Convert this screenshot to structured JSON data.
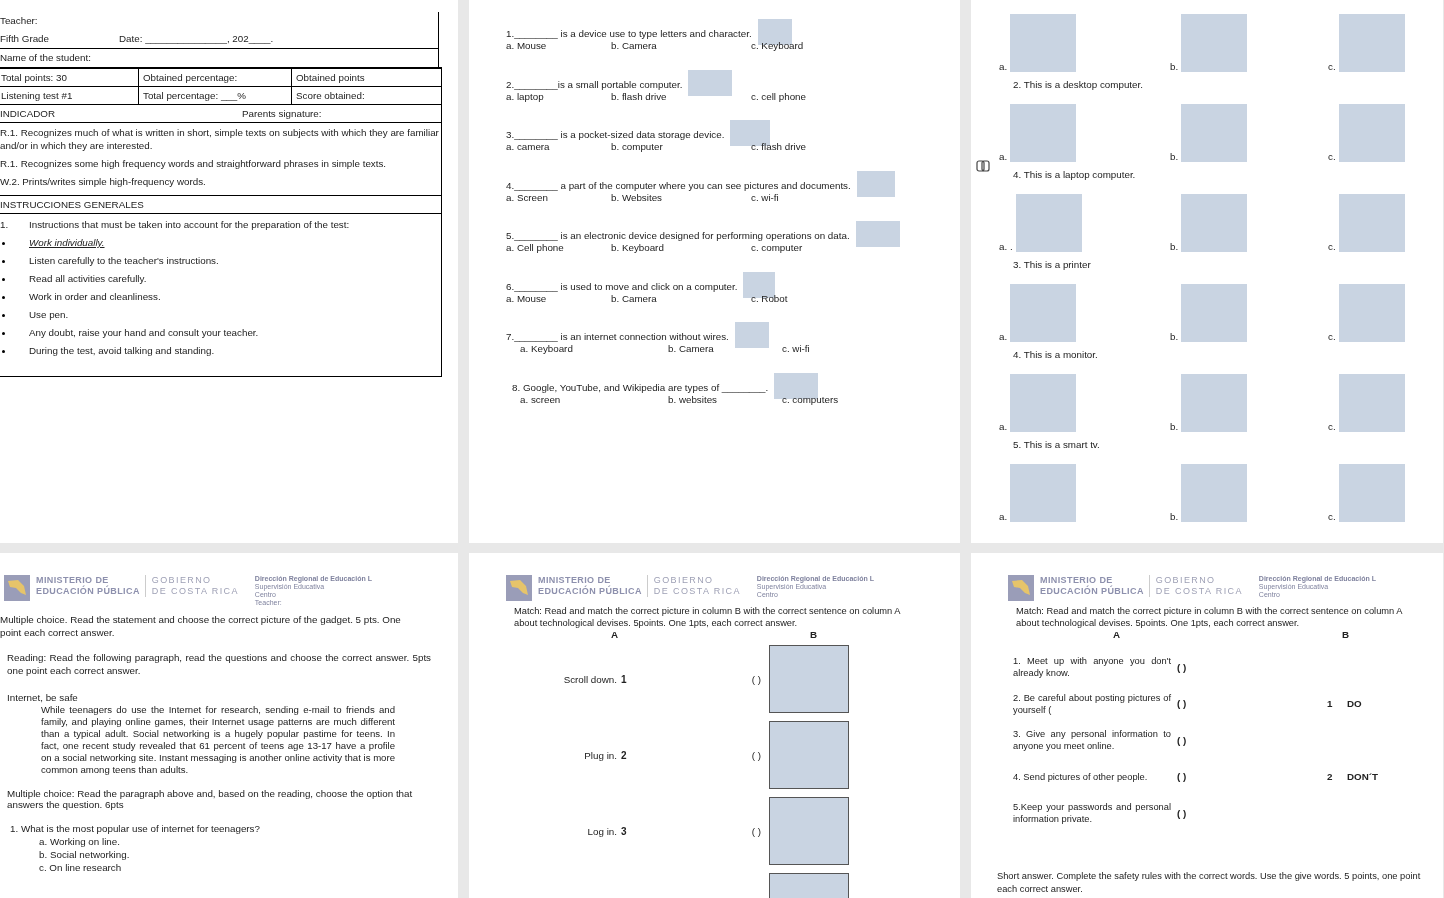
{
  "page_1": {
    "teacher": "Teacher:",
    "grade": "Fifth Grade",
    "date": "Date: _______________, 202____.",
    "student": "Name of the student:",
    "score_rows": [
      [
        "Total points: 30",
        "Obtained percentage:",
        "Obtained points"
      ],
      [
        "Listening test #1",
        "Total percentage: ___%",
        "Score obtained:"
      ]
    ],
    "indicator": "INDICADOR",
    "signature": "Parents signature:",
    "indicators": [
      "R.1. Recognizes much of what is written in short, simple texts on subjects with which they are familiar and/or in which they are interested.",
      "R.1. Recognizes some high frequency words and straightforward phrases in simple texts.",
      "W.2. Prints/writes simple high-frequency words."
    ],
    "instructions_title": "INSTRUCCIONES GENERALES",
    "instruction_number": "1.",
    "instruction_lead": "Instructions that must be taken into account for the preparation of the test:",
    "rules": [
      {
        "text": "Work individually.",
        "emphasized": true
      },
      {
        "text": "Listen carefully to the teacher's instructions.",
        "emphasized": false
      },
      {
        "text": "Read all activities carefully.",
        "emphasized": false
      },
      {
        "text": "Work in order and cleanliness.",
        "emphasized": false
      },
      {
        "text": "Use pen.",
        "emphasized": false
      },
      {
        "text": "Any doubt, raise your hand and consult your teacher.",
        "emphasized": false
      },
      {
        "text": "During the test, avoid talking and standing.",
        "emphasized": false
      }
    ]
  },
  "page_2": {
    "questions": [
      {
        "text": "1.________ is a device use to type letters and character.",
        "options": [
          "a.  Mouse",
          "b. Camera",
          "c. Keyboard"
        ]
      },
      {
        "text": "2.________is a small portable computer.",
        "options": [
          "a.  laptop",
          "b. flash drive",
          "c. cell phone"
        ]
      },
      {
        "text": "3.________ is a pocket-sized data storage device.",
        "options": [
          "a.  camera",
          "b. computer",
          "c. flash drive"
        ]
      },
      {
        "text": "4.________ a part of the computer where you can see pictures and documents.",
        "options": [
          "a.  Screen",
          "b. Websites",
          "c. wi-fi"
        ]
      },
      {
        "text": "5.________ is an electronic device designed for performing operations on data.",
        "options": [
          "a.  Cell phone",
          "b. Keyboard",
          "c. computer"
        ]
      },
      {
        "text": "6.________ is used to move and click on a computer.",
        "options": [
          "a.  Mouse",
          "b. Camera",
          "c. Robot"
        ]
      },
      {
        "text": "7.________ is an internet connection without wires.",
        "options": [
          "a.  Keyboard",
          "b. Camera",
          "c. wi-fi"
        ]
      },
      {
        "text": "8.  Google, YouTube, and Wikipedia are types of ________.",
        "options": [
          "a.  screen",
          "b. websites",
          "c. computers"
        ]
      }
    ]
  },
  "page_3": {
    "rows": [
      {
        "labels": [
          "a.",
          "b.",
          "c."
        ]
      },
      {
        "caption": "2.  This is a desktop computer.",
        "labels": [
          "a.",
          "b.",
          "c."
        ]
      },
      {
        "caption": "4. This is a laptop computer.",
        "labels": [
          "a. .",
          "b.",
          "c."
        ]
      },
      {
        "caption": "3.  This is a printer",
        "labels": [
          "a.",
          "b.",
          "c."
        ]
      },
      {
        "caption": "4.  This is a monitor.",
        "labels": [
          "a.",
          "b.",
          "c."
        ]
      },
      {
        "caption": "5.  This is a smart tv.",
        "labels": [
          "a.",
          "b.",
          "c."
        ]
      }
    ]
  },
  "page_4": {
    "header": {
      "ministry": [
        "MINISTERIO DE",
        "EDUCACIÓN PÚBLICA"
      ],
      "government": [
        "GOBIERNO",
        "DE COSTA RICA"
      ],
      "office": [
        "Dirección Regional de Educación L",
        "Supervisión Educativa",
        "Centro",
        "Teacher:"
      ]
    },
    "gadget_instruction": "Multiple choice. Read the statement and choose the correct picture of the gadget. 5 pts. One point each correct answer.",
    "reading_instruction": "Reading: Read the following paragraph, read the questions and choose the correct answer. 5pts one point each correct answer.",
    "reading_title": "Internet, be safe",
    "reading_text": "While teenagers do use the Internet for research, sending e-mail to friends and family, and playing online games, their Internet usage patterns are much different than a typical adult. Social networking is a hugely popular pastime for teens. In fact, one recent study revealed that 61 percent of teens age 13-17 have a profile on a social networking site. Instant messaging is another online activity that is more common among teens than adults.",
    "choice_instruction": "Multiple choice: Read the paragraph above and, based on the reading, choose the option that answers the question. 6pts",
    "question": "1.  What is the most popular use of internet for teenagers?",
    "options": [
      "a.  Working on line.",
      "b.  Social networking.",
      "c.  On line research"
    ]
  },
  "page_5": {
    "header": {
      "ministry": [
        "MINISTERIO DE",
        "EDUCACIÓN PÚBLICA"
      ],
      "government": [
        "GOBIERNO",
        "DE COSTA RICA"
      ],
      "office": [
        "Dirección Regional de Educación L",
        "Supervisión Educativa",
        "Centro"
      ]
    },
    "instruction": "Match: Read and match the correct picture in column B with the correct sentence on column A about technological devises. 5points. One 1pts, each correct answer.",
    "column_a": "A",
    "column_b": "B",
    "rows": [
      {
        "text": "Scroll down.",
        "number": "1",
        "answer": "(    )"
      },
      {
        "text": "Plug in.",
        "number": "2",
        "answer": "(    )"
      },
      {
        "text": "Log in.",
        "number": "3",
        "answer": "(    )"
      }
    ]
  },
  "page_6": {
    "header": {
      "ministry": [
        "MINISTERIO DE",
        "EDUCACIÓN PÚBLICA"
      ],
      "government": [
        "GOBIERNO",
        "DE COSTA RICA"
      ],
      "office": [
        "Dirección Regional de Educación L",
        "Supervisión Educativa",
        "Centro"
      ]
    },
    "instruction": "Match: Read and match the correct picture in column B with the correct sentence on column A about technological devises. 5points. One 1pts, each correct answer.",
    "column_a": "A",
    "column_b": "B",
    "rows": [
      {
        "text": "1. Meet up with anyone you don't already know.",
        "answer": "(    )"
      },
      {
        "text": "2. Be careful about posting pictures of yourself (",
        "answer": "(    )",
        "option_number": "1",
        "option_word": "DO"
      },
      {
        "text": "3. Give any personal information to anyone you meet online.",
        "answer": "(    )"
      },
      {
        "text": "4. Send pictures of other people.",
        "answer": "(    )",
        "option_number": "2",
        "option_word": "DON´T"
      },
      {
        "text": "5.Keep your passwords and personal information private.",
        "answer": "(    )"
      }
    ],
    "short_answer": "Short answer. Complete the safety rules with the correct words. Use the give words. 5 points, one point each correct answer."
  }
}
